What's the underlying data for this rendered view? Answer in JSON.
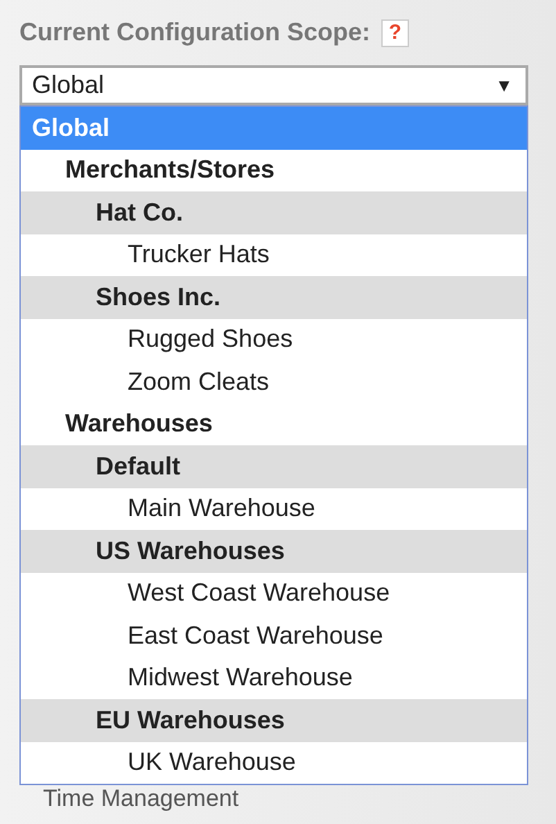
{
  "scope_label": "Current Configuration Scope:",
  "help_badge": "?",
  "scope_select": {
    "value": "Global",
    "arrow": "▼"
  },
  "dropdown_options": [
    {
      "label": "Global",
      "selected": true,
      "children": [
        {
          "label": "Merchants/Stores",
          "selected": false,
          "children": [
            {
              "label": "Hat Co.",
              "selected": false,
              "children": [
                {
                  "label": "Trucker Hats",
                  "selected": false
                }
              ]
            },
            {
              "label": "Shoes Inc.",
              "selected": false,
              "children": [
                {
                  "label": "Rugged Shoes",
                  "selected": false
                },
                {
                  "label": "Zoom Cleats",
                  "selected": false
                }
              ]
            }
          ]
        },
        {
          "label": "Warehouses",
          "selected": false,
          "children": [
            {
              "label": "Default",
              "selected": false,
              "children": [
                {
                  "label": "Main Warehouse",
                  "selected": false
                }
              ]
            },
            {
              "label": "US Warehouses",
              "selected": false,
              "children": [
                {
                  "label": "West Coast Warehouse",
                  "selected": false
                },
                {
                  "label": "East Coast Warehouse",
                  "selected": false
                },
                {
                  "label": "Midwest Warehouse",
                  "selected": false
                }
              ]
            },
            {
              "label": "EU Warehouses",
              "selected": false,
              "children": [
                {
                  "label": "UK Warehouse",
                  "selected": false
                }
              ]
            }
          ]
        }
      ]
    }
  ],
  "background_menu_item": "Time Management"
}
